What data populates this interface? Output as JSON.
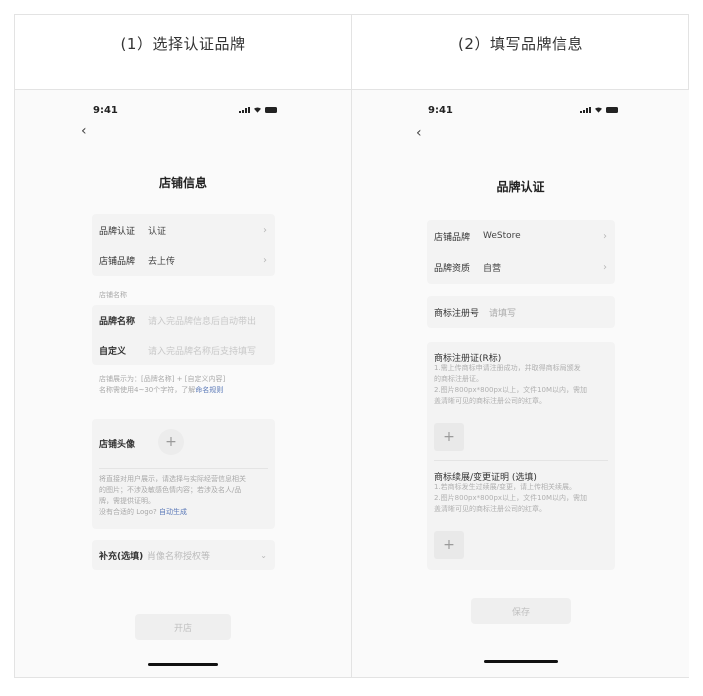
{
  "captions": {
    "step1": "(1）选择认证品牌",
    "step2": "(2）填写品牌信息"
  },
  "status_bar": {
    "time": "9:41"
  },
  "screen1": {
    "title": "店铺信息",
    "rows": [
      {
        "label": "品牌认证",
        "value": "认证"
      },
      {
        "label": "店铺品牌",
        "value": "去上传"
      }
    ],
    "section_label": "店铺名称",
    "name_fields": [
      {
        "label": "品牌名称",
        "placeholder": "请入完品牌信息后自动带出"
      },
      {
        "label": "自定义",
        "placeholder": "请入完品牌名称后支持填写"
      }
    ],
    "name_note_1": "店铺展示为：[品牌名称] + [自定义内容]",
    "name_note_2": "名称需使用4~30个字符，了解",
    "name_rule_link": "命名规则",
    "avatar_label": "店铺头像",
    "avatar_note_1": "将直接对用户展示，请选择与实际经营信息相关",
    "avatar_note_2": "的图片；不涉及敏感色情内容；若涉及名人/品",
    "avatar_note_3": "牌，需提供证明。",
    "avatar_note_4": "没有合适的 Logo?",
    "avatar_auto_link": "自动生成",
    "supplement_label": "补充(选填)",
    "supplement_placeholder": "肖像名称授权等",
    "submit_label": "开店"
  },
  "screen2": {
    "title": "品牌认证",
    "rows": [
      {
        "label": "店铺品牌",
        "value": "WeStore"
      },
      {
        "label": "品牌资质",
        "value": "自营"
      }
    ],
    "tm_number_label": "商标注册号",
    "tm_number_placeholder": "请填写",
    "cert_title": "商标注册证(R标)",
    "cert_note_1": "1.需上传商标申请注册成功，并取得商标局颁发",
    "cert_note_2": "的商标注册证。",
    "cert_note_3": "2.图片800px*800px以上，文件10M以内，需加",
    "cert_note_4": "盖清晰可见的商标注册公司的红章。",
    "renew_title": "商标续展/变更证明 (选填)",
    "renew_note_1": "1.若商标发生过续展/变更，请上传相关续展。",
    "renew_note_2": "2.图片800px*800px以上，文件10M以内，需加",
    "renew_note_3": "盖清晰可见的商标注册公司的红章。",
    "save_label": "保存"
  }
}
